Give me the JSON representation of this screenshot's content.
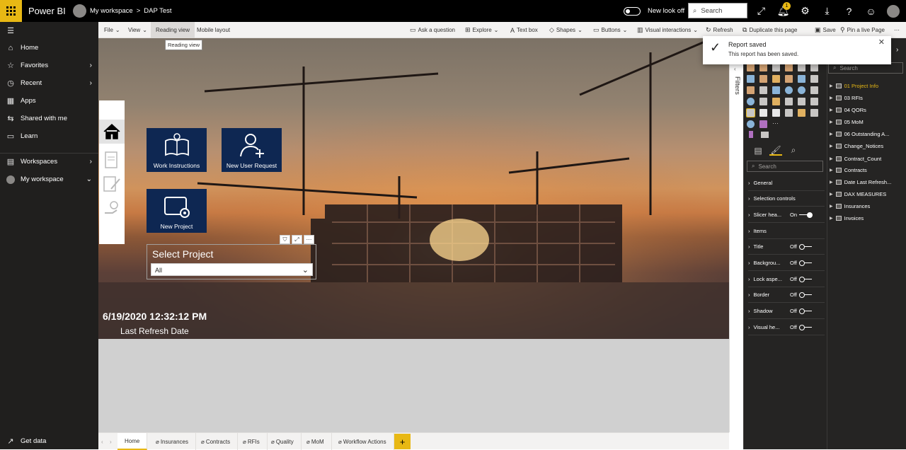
{
  "topbar": {
    "brand": "Power BI",
    "breadcrumb_workspace": "My workspace",
    "breadcrumb_sep": ">",
    "breadcrumb_report": "DAP Test",
    "toggle_label": "New look off",
    "search_label": "Search",
    "notification_count": "1"
  },
  "sidebar": {
    "items": [
      {
        "label": "Home",
        "icon": "home-icon"
      },
      {
        "label": "Favorites",
        "icon": "star-icon"
      },
      {
        "label": "Recent",
        "icon": "clock-icon"
      },
      {
        "label": "Apps",
        "icon": "apps-icon"
      },
      {
        "label": "Shared with me",
        "icon": "shared-icon"
      },
      {
        "label": "Learn",
        "icon": "book-icon"
      },
      {
        "label": "Workspaces",
        "icon": "workspaces-icon"
      },
      {
        "label": "My workspace",
        "icon": "avatar-icon"
      }
    ],
    "get_data": "Get data"
  },
  "ribbon": {
    "file": "File",
    "view": "View",
    "reading_view": "Reading view",
    "mobile_layout": "Mobile layout",
    "ask_question": "Ask a question",
    "explore": "Explore",
    "text_box": "Text box",
    "shapes": "Shapes",
    "buttons": "Buttons",
    "visual_interactions": "Visual interactions",
    "refresh": "Refresh",
    "duplicate_page": "Duplicate this page",
    "save": "Save",
    "pin_live_page": "Pin a live Page"
  },
  "tooltip": "Reading view",
  "toast": {
    "title": "Report saved",
    "body": "This report has been saved."
  },
  "report": {
    "tiles": [
      {
        "label": "Work Instructions"
      },
      {
        "label": "New User Request"
      },
      {
        "label": "New Project"
      }
    ],
    "slicer_title": "Select Project",
    "slicer_value": "All",
    "datetime": "6/19/2020 12:32:12 PM",
    "refresh_label": "Last Refresh Date",
    "colors": {
      "tile": "#0e2752",
      "accent": "#e8b814"
    }
  },
  "tabs": [
    "Home",
    "Insurances",
    "Contracts",
    "RFIs",
    "Quality",
    "MoM",
    "Workflow Actions"
  ],
  "add_page": "+",
  "filters_label": "Filters",
  "visualizations": {
    "search_placeholder": "Search",
    "format_rows": [
      {
        "label": "General",
        "state": ""
      },
      {
        "label": "Selection controls",
        "state": ""
      },
      {
        "label": "Slicer hea...",
        "state": "On"
      },
      {
        "label": "Items",
        "state": ""
      },
      {
        "label": "Title",
        "state": "Off"
      },
      {
        "label": "Backgrou...",
        "state": "Off"
      },
      {
        "label": "Lock aspe...",
        "state": "Off"
      },
      {
        "label": "Border",
        "state": "Off"
      },
      {
        "label": "Shadow",
        "state": "Off"
      },
      {
        "label": "Visual he...",
        "state": "Off"
      }
    ]
  },
  "fields": {
    "search_placeholder": "Search",
    "tables": [
      "01 Project Info",
      "03 RFIs",
      "04 QORs",
      "05 MoM",
      "06 Outstanding A...",
      "Change_Notices",
      "Contract_Count",
      "Contracts",
      "Date Last Refresh...",
      "DAX MEASURES",
      "Insurances",
      "Invoices"
    ]
  }
}
